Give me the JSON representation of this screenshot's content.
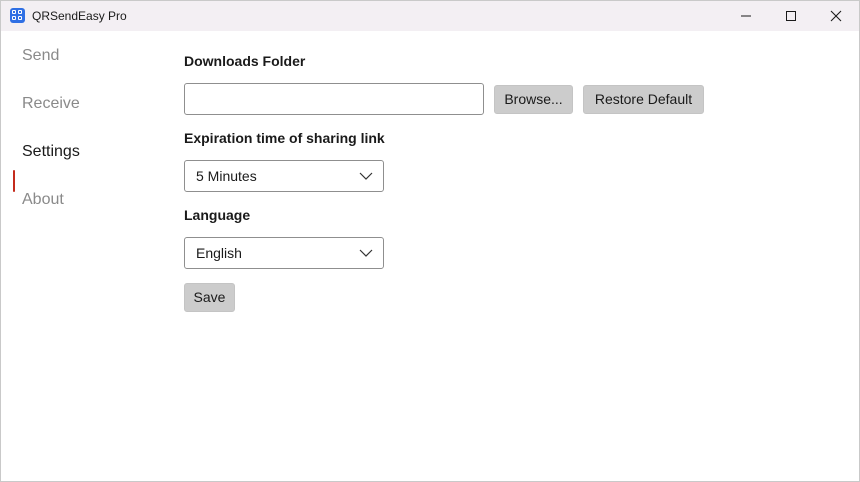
{
  "window": {
    "title": "QRSendEasy Pro",
    "controls": [
      "minimize-icon",
      "maximize-icon",
      "close-icon"
    ]
  },
  "sidebar": {
    "items": [
      {
        "label": "Send",
        "active": false
      },
      {
        "label": "Receive",
        "active": false
      },
      {
        "label": "Settings",
        "active": true
      },
      {
        "label": "About",
        "active": false
      }
    ]
  },
  "settings": {
    "downloads_folder_label": "Downloads Folder",
    "downloads_folder_value": "",
    "browse_label": "Browse...",
    "restore_default_label": "Restore Default",
    "expiration_label": "Expiration time of sharing link",
    "expiration_value": "5 Minutes",
    "language_label": "Language",
    "language_value": "English",
    "save_label": "Save"
  },
  "colors": {
    "accent_indicator": "#c42b1c",
    "app_icon": "#2f6fe4",
    "button_bg": "#cccccc",
    "titlebar_bg": "#f3eff3"
  }
}
